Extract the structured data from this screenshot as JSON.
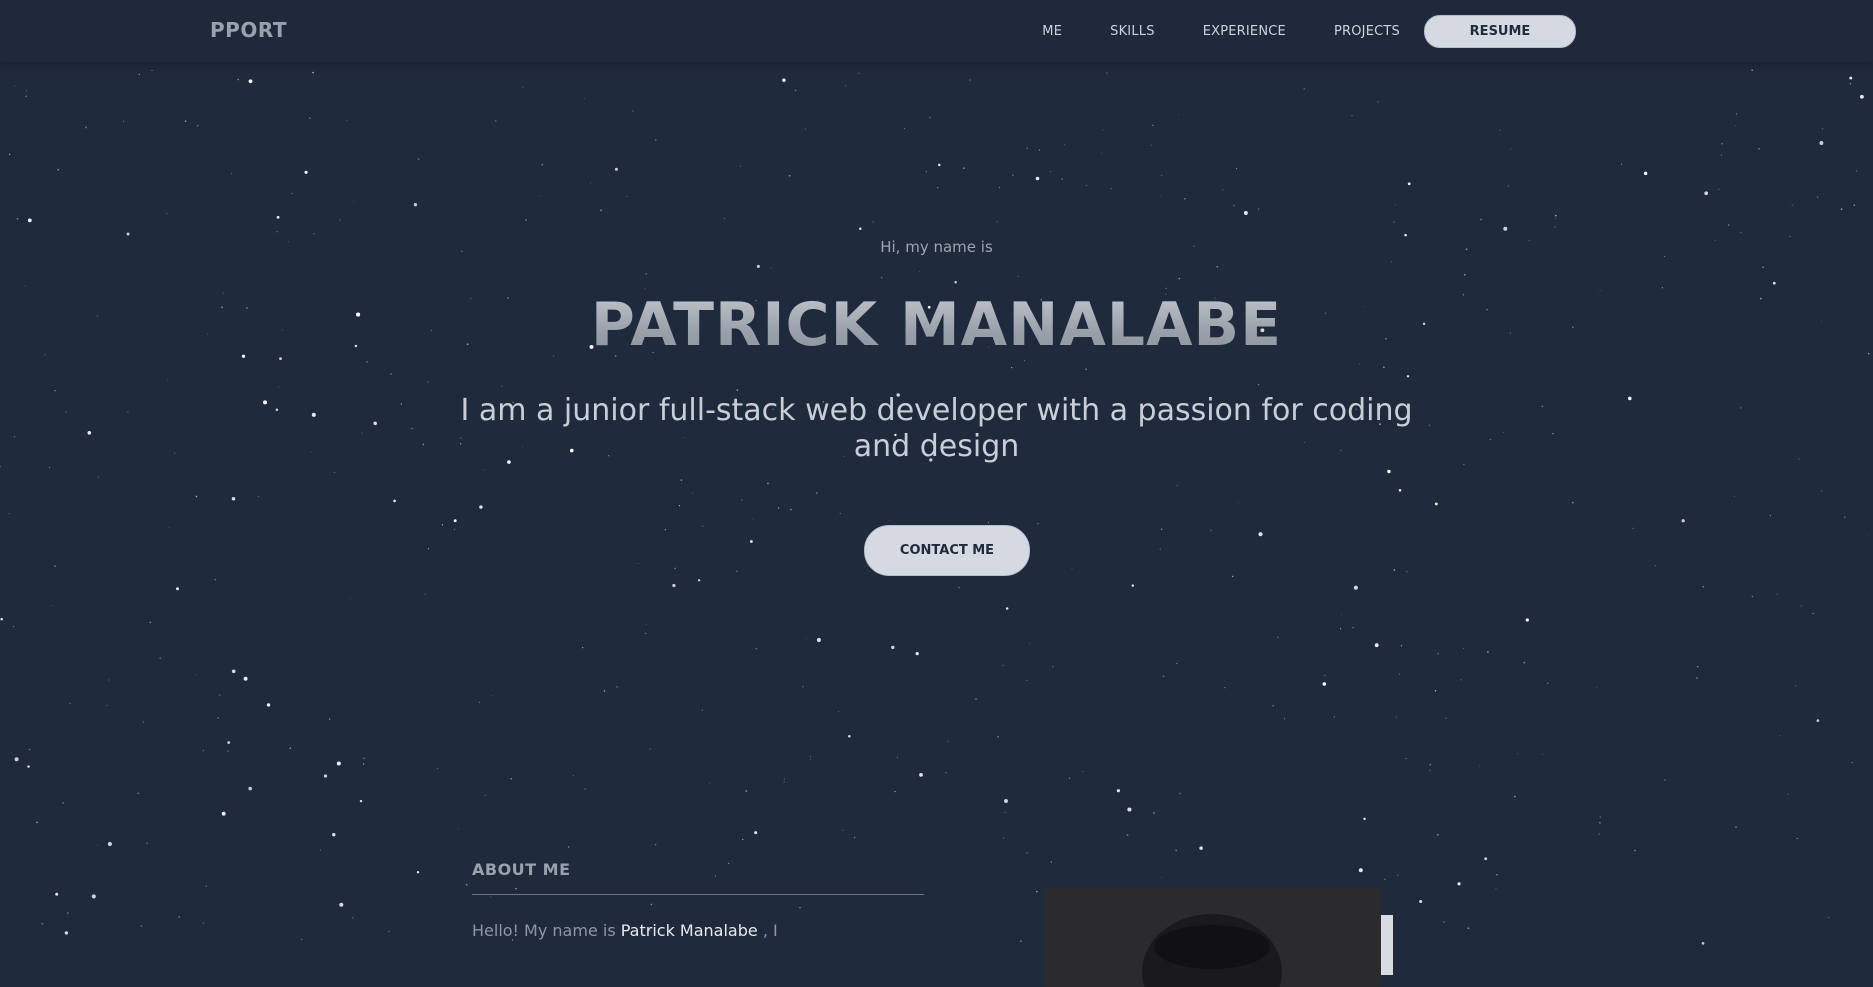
{
  "navbar": {
    "brand": "PPORT",
    "links": [
      "ME",
      "SKILLS",
      "EXPERIENCE",
      "PROJECTS"
    ],
    "resume_label": "RESUME"
  },
  "hero": {
    "greeting": "Hi, my name is",
    "name": "PATRICK MANALABE",
    "tagline": "I am a junior full-stack web developer with a passion for coding and design",
    "contact_label": "CONTACT ME"
  },
  "about": {
    "title": "ABOUT ME",
    "intro_prefix": "Hello! My name is",
    "intro_name": "Patrick Manalabe",
    "intro_suffix": ", I"
  },
  "colors": {
    "background": "#1f2a3d",
    "navbar": "#1f293b",
    "button": "#d5d9e1",
    "muted_text": "#9aa1ad",
    "star": "#ffffff"
  },
  "icons": {
    "background_decoration": "starfield"
  }
}
